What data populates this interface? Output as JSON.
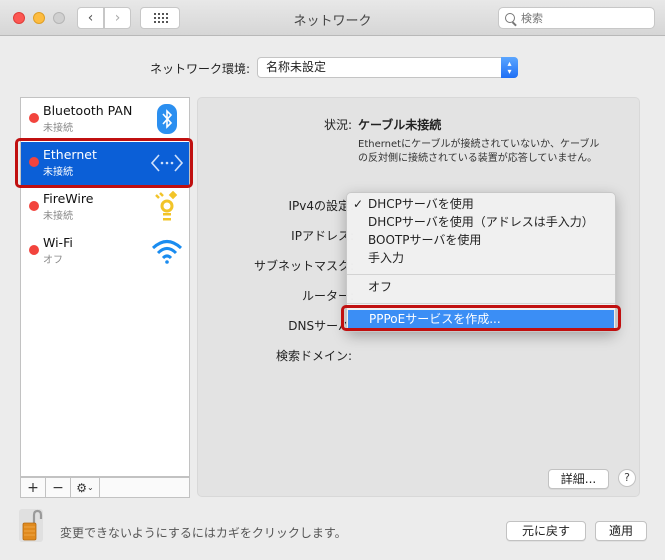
{
  "window": {
    "title": "ネットワーク",
    "search_placeholder": "検索"
  },
  "location": {
    "label": "ネットワーク環境:",
    "value": "名称未設定"
  },
  "services": [
    {
      "name": "Bluetooth PAN",
      "status": "未接続",
      "icon": "bluetooth-icon",
      "selected": false
    },
    {
      "name": "Ethernet",
      "status": "未接続",
      "icon": "ethernet-icon",
      "selected": true
    },
    {
      "name": "FireWire",
      "status": "未接続",
      "icon": "firewire-icon",
      "selected": false
    },
    {
      "name": "Wi-Fi",
      "status": "オフ",
      "icon": "wifi-icon",
      "selected": false
    }
  ],
  "list_toolbar": {
    "add": "+",
    "remove": "−"
  },
  "detail": {
    "status_label": "状況:",
    "status_value": "ケーブル未接続",
    "status_description": "Ethernetにケーブルが接続されていないか、ケーブルの反対側に接続されている装置が応答していません。",
    "ipv4_label": "IPv4の設定:",
    "ip_label": "IPアドレス:",
    "subnet_label": "サブネットマスク:",
    "router_label": "ルーター:",
    "dns_label": "DNSサーバ:",
    "search_domain_label": "検索ドメイン:",
    "advanced_button": "詳細...",
    "help_button": "?"
  },
  "ipv4_menu": {
    "items": [
      {
        "label": "DHCPサーバを使用",
        "checked": true
      },
      {
        "label": "DHCPサーバを使用（アドレスは手入力）",
        "checked": false
      },
      {
        "label": "BOOTPサーバを使用",
        "checked": false
      },
      {
        "label": "手入力",
        "checked": false
      },
      {
        "label": "オフ",
        "checked": false
      },
      {
        "label": "PPPoEサービスを作成...",
        "checked": false,
        "highlighted": true
      }
    ],
    "check_mark": "✓"
  },
  "footer": {
    "lock_text": "変更できないようにするにはカギをクリックします。",
    "revert_button": "元に戻す",
    "apply_button": "適用"
  },
  "colors": {
    "selection": "#0b5fd7",
    "menu_highlight": "#3b8ef5",
    "status_dot": "#f2443d",
    "annotation_box": "#c01010"
  }
}
